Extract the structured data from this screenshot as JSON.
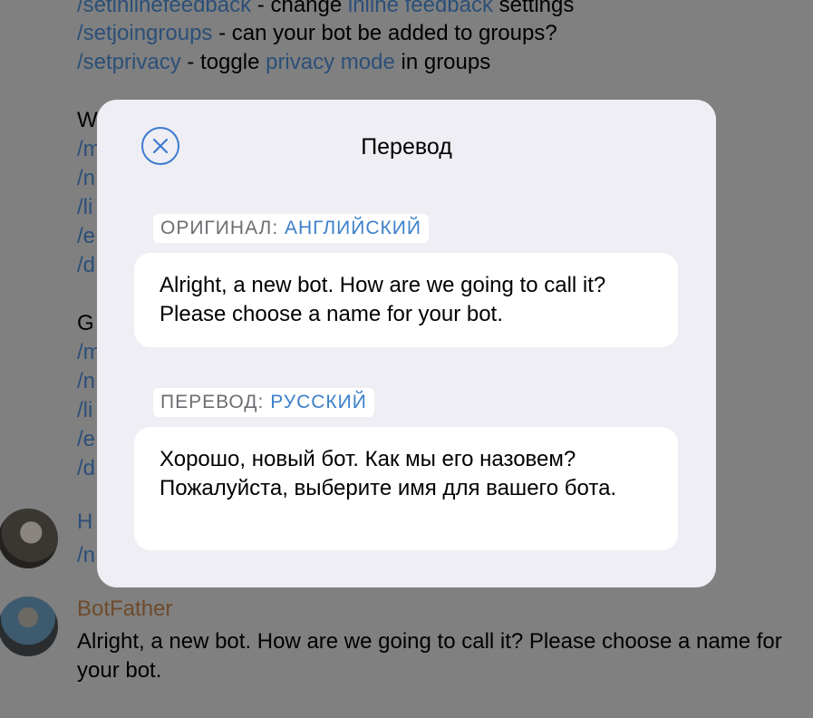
{
  "background_chat": {
    "lines_top": [
      {
        "cmd": "/setinlinefeedback",
        "sep": " - change ",
        "link": "inline feedback",
        "rest": " settings"
      },
      {
        "cmd": "/setjoingroups",
        "sep": " - can your bot be added to groups?",
        "link": "",
        "rest": ""
      },
      {
        "cmd": "/setprivacy",
        "sep": " - toggle ",
        "link": "privacy mode",
        "rest": " in groups"
      }
    ],
    "section_w_initial": "W",
    "section_g_initial": "G",
    "partial_cmds_1": [
      "/m",
      "/n",
      "/li",
      "/e",
      "/d"
    ],
    "partial_cmds_2": [
      "/m",
      "/n",
      "/li",
      "/e",
      "/d"
    ],
    "partial_sender": "H",
    "partial_sender_cmd": "/n",
    "bot_name": "BotFather",
    "bot_message": "Alright, a new bot. How are we going to call it? Please choose a name for your bot."
  },
  "modal": {
    "title": "Перевод",
    "original_label": "ОРИГИНАЛ:",
    "original_lang": "АНГЛИЙСКИЙ",
    "original_text": "Alright, a new bot. How are we going to call it? Please choose a name for your bot.",
    "translation_label": "ПЕРЕВОД:",
    "translation_lang": "РУССКИЙ",
    "translation_text": "Хорошо, новый бот. Как мы его назовем? Пожалуйста, выберите имя для вашего бота."
  },
  "colors": {
    "accent": "#3c80c8",
    "overlay": "#808080",
    "modal_bg": "#efeef4",
    "bot_name": "#6e4a2b"
  },
  "icons": {
    "close": "close-circle-icon"
  }
}
